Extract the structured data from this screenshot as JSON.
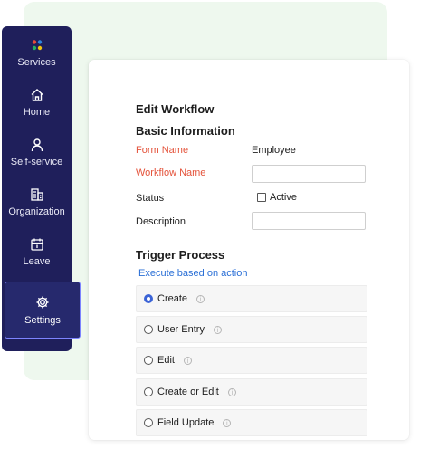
{
  "sidebar": {
    "items": [
      {
        "label": "Services",
        "icon": "services-icon"
      },
      {
        "label": "Home",
        "icon": "home-icon"
      },
      {
        "label": "Self-service",
        "icon": "user-icon"
      },
      {
        "label": "Organization",
        "icon": "building-icon"
      },
      {
        "label": "Leave",
        "icon": "calendar-icon"
      },
      {
        "label": "Settings",
        "icon": "gear-icon",
        "active": true
      }
    ],
    "colors": {
      "background": "#1f1f5b",
      "active_border": "#7d84ff",
      "dots": [
        "#e74c3c",
        "#2e86de",
        "#27ae60",
        "#f1c40f"
      ]
    }
  },
  "form": {
    "title": "Edit Workflow",
    "basic_section": "Basic Information",
    "form_name_label": "Form Name",
    "form_name_value": "Employee",
    "workflow_name_label": "Workflow Name",
    "workflow_name_value": "",
    "status_label": "Status",
    "status_checkbox_label": "Active",
    "description_label": "Description",
    "description_value": "",
    "trigger_section": "Trigger Process",
    "execute_link": "Execute based on action",
    "options": [
      {
        "label": "Create",
        "selected": true
      },
      {
        "label": "User Entry",
        "selected": false
      },
      {
        "label": "Edit",
        "selected": false
      },
      {
        "label": "Create or Edit",
        "selected": false
      },
      {
        "label": "Field Update",
        "selected": false
      }
    ],
    "colors": {
      "required_label": "#e4533b",
      "link": "#2a6fd6",
      "radio_selected": "#3b63d6"
    }
  }
}
